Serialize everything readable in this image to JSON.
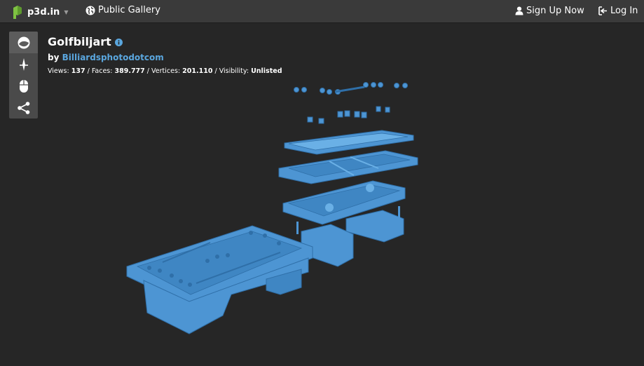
{
  "nav": {
    "brand": "p3d.in",
    "gallery_label": "Public Gallery",
    "signup_label": "Sign Up Now",
    "login_label": "Log In"
  },
  "model": {
    "title": "Golfbiljart",
    "by_label": "by",
    "author": "Billiardsphotodotcom",
    "stats": {
      "views_label": "Views:",
      "views": "137",
      "faces_label": "Faces:",
      "faces": "389.777",
      "vertices_label": "Vertices:",
      "vertices": "201.110",
      "visibility_label": "Visibility:",
      "visibility": "Unlisted"
    }
  },
  "toolbar": {
    "tools": [
      "material-icon",
      "lighting-icon",
      "mouse-icon",
      "share-icon"
    ]
  },
  "colors": {
    "topbar": "#3a3a3a",
    "background": "#262626",
    "toolbar": "#4a4a4a",
    "link_blue": "#5aa6de",
    "model_blue": "#4d95d3",
    "logo_green": "#7ec242"
  }
}
